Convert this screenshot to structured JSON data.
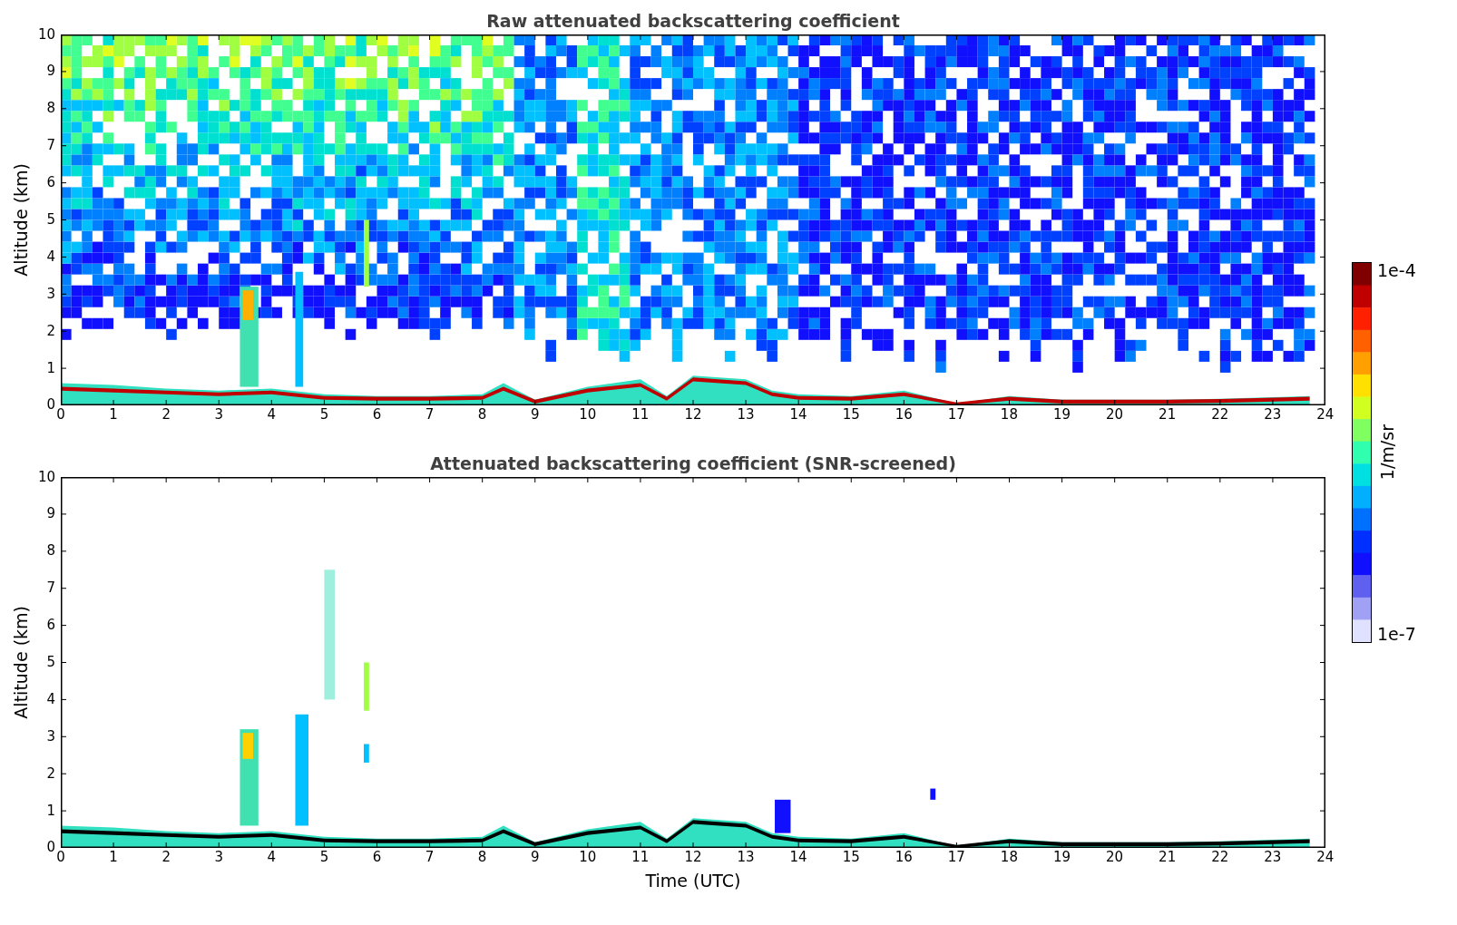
{
  "panels": [
    {
      "title": "Raw attenuated backscattering coefficient",
      "ylabel": "Altitude (km)",
      "kind": "raw",
      "yticks": [
        "10",
        "9",
        "8",
        "7",
        "6",
        "5",
        "4",
        "3",
        "2",
        "1",
        "0"
      ],
      "xticks": [
        "0",
        "1",
        "2",
        "3",
        "4",
        "5",
        "6",
        "7",
        "8",
        "9",
        "10",
        "11",
        "12",
        "13",
        "14",
        "15",
        "16",
        "17",
        "18",
        "19",
        "20",
        "21",
        "22",
        "23",
        "24"
      ]
    },
    {
      "title": "Attenuated backscattering coefficient (SNR-screened)",
      "ylabel": "Altitude (km)",
      "kind": "screened",
      "yticks": [
        "10",
        "9",
        "8",
        "7",
        "6",
        "5",
        "4",
        "3",
        "2",
        "1",
        "0"
      ],
      "xticks": [
        "0",
        "1",
        "2",
        "3",
        "4",
        "5",
        "6",
        "7",
        "8",
        "9",
        "10",
        "11",
        "12",
        "13",
        "14",
        "15",
        "16",
        "17",
        "18",
        "19",
        "20",
        "21",
        "22",
        "23",
        "24"
      ],
      "xlabel": "Time (UTC)"
    }
  ],
  "colorbar": {
    "max_label": "1e-4",
    "min_label": "1e-7",
    "label": "1/m/sr"
  }
}
